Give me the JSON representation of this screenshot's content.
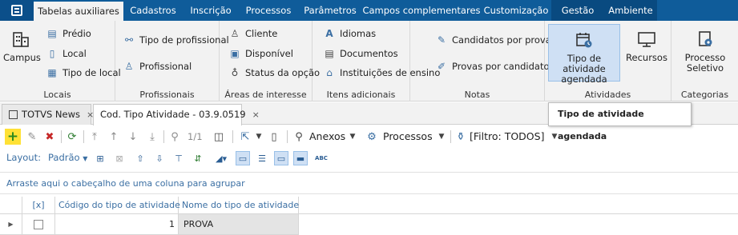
{
  "ribbon_tabs": [
    "Tabelas auxiliares",
    "Cadastros",
    "Inscrição",
    "Processos",
    "Parâmetros",
    "Campos complementares",
    "Customização",
    "Gestão",
    "Ambiente"
  ],
  "groups": {
    "locais": {
      "label": "Locais",
      "campus": "Campus",
      "items": [
        "Prédio",
        "Local",
        "Tipo de local"
      ]
    },
    "profissionais": {
      "label": "Profissionais",
      "items": [
        "Tipo de profissional",
        "Profissional"
      ]
    },
    "areas": {
      "label": "Áreas de interesse",
      "items": [
        "Cliente",
        "Disponível",
        "Status da opção"
      ]
    },
    "itens": {
      "label": "Itens adicionais",
      "items": [
        "Idiomas",
        "Documentos",
        "Instituições de ensino"
      ]
    },
    "notas": {
      "label": "Notas",
      "items": [
        "Candidatos por prova",
        "Provas por candidato"
      ]
    },
    "atividades": {
      "label": "Atividades",
      "tipo": "Tipo de atividade agendada",
      "recursos": "Recursos"
    },
    "categorias": {
      "label": "Categorias",
      "processo": "Processo Seletivo"
    }
  },
  "tooltip": "Tipo de atividade agendada",
  "doc_tabs": [
    {
      "label": "TOTVS News",
      "close": "×"
    },
    {
      "label": "Cod. Tipo Atividade - 03.9.0519",
      "close": "×"
    }
  ],
  "toolbar": {
    "page_indicator": "1/1",
    "anexos": "Anexos",
    "processos": "Processos",
    "filtro": "[Filtro: TODOS]"
  },
  "layoutbar": {
    "label": "Layout:",
    "padrao": "Padrão"
  },
  "group_hint": "Arraste aqui o cabeçalho de uma coluna para agrupar",
  "grid": {
    "headers": [
      "[x]",
      "Código do tipo de atividade",
      "Nome do tipo de atividade"
    ],
    "rows": [
      {
        "codigo": "1",
        "nome": "PROVA"
      }
    ]
  },
  "colors": {
    "tabbar": "#0f5c9a",
    "add_button": "#ffe135",
    "link_blue": "#3b6fa3"
  }
}
